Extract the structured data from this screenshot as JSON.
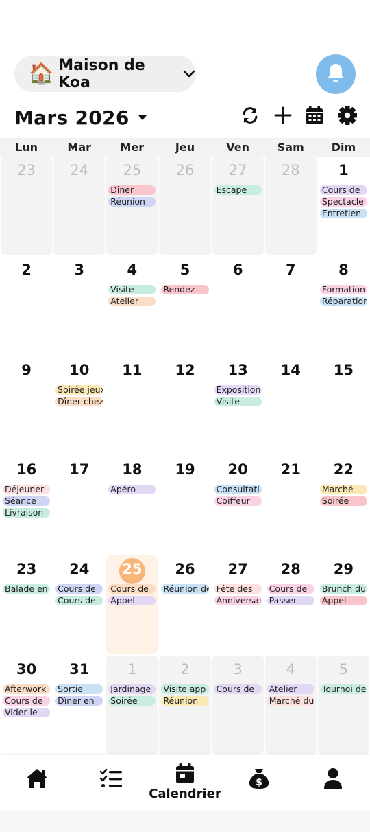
{
  "header": {
    "house_emoji": "🏠",
    "house_name": "Maison de Koa",
    "month_title": "Mars 2026"
  },
  "icons": {
    "chevron": "chevron-down-icon",
    "bell": "bell-icon",
    "refresh": "refresh-icon",
    "add": "plus-icon",
    "calendar": "calendar-icon",
    "settings": "gear-icon"
  },
  "colors": {
    "bell_bg": "#7fbcec",
    "today_circle": "#f9b67a",
    "today_bg": "#fff3e8"
  },
  "weekdays": [
    "Lun",
    "Mar",
    "Mer",
    "Jeu",
    "Ven",
    "Sam",
    "Dim"
  ],
  "weeks": [
    [
      {
        "day": "23",
        "other": true,
        "events": []
      },
      {
        "day": "24",
        "other": true,
        "events": []
      },
      {
        "day": "25",
        "other": true,
        "events": [
          {
            "label": "Dîner",
            "color": "#f9c5cd"
          },
          {
            "label": "Réunion",
            "color": "#cfd6f5"
          }
        ]
      },
      {
        "day": "26",
        "other": true,
        "events": []
      },
      {
        "day": "27",
        "other": true,
        "events": [
          {
            "label": "Escape",
            "color": "#c8ecdf"
          }
        ]
      },
      {
        "day": "28",
        "other": true,
        "events": []
      },
      {
        "day": "1",
        "other": false,
        "events": [
          {
            "label": "Cours de",
            "color": "#e3d7f6"
          },
          {
            "label": "Spectacle",
            "color": "#f9d2e6"
          },
          {
            "label": "Entretien",
            "color": "#c9e1f4"
          }
        ]
      }
    ],
    [
      {
        "day": "2",
        "other": false,
        "events": []
      },
      {
        "day": "3",
        "other": false,
        "events": []
      },
      {
        "day": "4",
        "other": false,
        "events": [
          {
            "label": "Visite",
            "color": "#c8ecdf"
          },
          {
            "label": "Atelier",
            "color": "#fbdcc4"
          }
        ]
      },
      {
        "day": "5",
        "other": false,
        "events": [
          {
            "label": "Rendez-",
            "color": "#f9c5cd"
          }
        ]
      },
      {
        "day": "6",
        "other": false,
        "events": []
      },
      {
        "day": "7",
        "other": false,
        "events": []
      },
      {
        "day": "8",
        "other": false,
        "events": [
          {
            "label": "Formation",
            "color": "#f9d2e6"
          },
          {
            "label": "Réparation",
            "color": "#c9e1f4"
          }
        ]
      }
    ],
    [
      {
        "day": "9",
        "other": false,
        "events": []
      },
      {
        "day": "10",
        "other": false,
        "events": [
          {
            "label": "Soirée jeux",
            "color": "#fbe9b5"
          },
          {
            "label": "Dîner chez",
            "color": "#fbdcc4"
          }
        ]
      },
      {
        "day": "11",
        "other": false,
        "events": []
      },
      {
        "day": "12",
        "other": false,
        "events": []
      },
      {
        "day": "13",
        "other": false,
        "events": [
          {
            "label": "Exposition",
            "color": "#e3d7f6"
          },
          {
            "label": "Visite",
            "color": "#c8ecdf"
          }
        ]
      },
      {
        "day": "14",
        "other": false,
        "events": []
      },
      {
        "day": "15",
        "other": false,
        "events": []
      }
    ],
    [
      {
        "day": "16",
        "other": false,
        "events": [
          {
            "label": "Déjeuner",
            "color": "#fde0e0"
          },
          {
            "label": "Séance",
            "color": "#cfd6f5"
          },
          {
            "label": "Livraison",
            "color": "#c8ecdf"
          }
        ]
      },
      {
        "day": "17",
        "other": false,
        "events": []
      },
      {
        "day": "18",
        "other": false,
        "events": [
          {
            "label": "Apéro",
            "color": "#e3d7f6"
          }
        ]
      },
      {
        "day": "19",
        "other": false,
        "events": []
      },
      {
        "day": "20",
        "other": false,
        "events": [
          {
            "label": "Consultati",
            "color": "#c9e1f4"
          },
          {
            "label": "Coiffeur",
            "color": "#f9d2e6"
          }
        ]
      },
      {
        "day": "21",
        "other": false,
        "events": []
      },
      {
        "day": "22",
        "other": false,
        "events": [
          {
            "label": "Marché",
            "color": "#fbe9b5"
          },
          {
            "label": "Soirée",
            "color": "#f9c5cd"
          }
        ]
      }
    ],
    [
      {
        "day": "23",
        "other": false,
        "events": [
          {
            "label": "Balade en",
            "color": "#c8ecdf"
          }
        ]
      },
      {
        "day": "24",
        "other": false,
        "events": [
          {
            "label": "Cours de",
            "color": "#cfd6f5"
          },
          {
            "label": "Cours de",
            "color": "#c8ecdf"
          }
        ]
      },
      {
        "day": "25",
        "other": false,
        "today": true,
        "events": [
          {
            "label": "Cours de",
            "color": "#fbdcc4"
          },
          {
            "label": "Appel",
            "color": "#e3d7f6"
          }
        ]
      },
      {
        "day": "26",
        "other": false,
        "events": [
          {
            "label": "Réunion de",
            "color": "#c9e1f4"
          }
        ]
      },
      {
        "day": "27",
        "other": false,
        "events": [
          {
            "label": "Fête des",
            "color": "#fde0e0"
          },
          {
            "label": "Anniversai",
            "color": "#f9d2e6"
          }
        ]
      },
      {
        "day": "28",
        "other": false,
        "events": [
          {
            "label": "Cours de",
            "color": "#f9d2e6"
          },
          {
            "label": "Passer",
            "color": "#e3d7f6"
          }
        ]
      },
      {
        "day": "29",
        "other": false,
        "events": [
          {
            "label": "Brunch du",
            "color": "#c8ecdf"
          },
          {
            "label": "Appel",
            "color": "#f9c5cd"
          }
        ]
      }
    ],
    [
      {
        "day": "30",
        "other": false,
        "events": [
          {
            "label": "Afterwork",
            "color": "#fbdcc4"
          },
          {
            "label": "Cours de",
            "color": "#f9d2e6"
          },
          {
            "label": "Vider le",
            "color": "#e3d7f6"
          }
        ]
      },
      {
        "day": "31",
        "other": false,
        "events": [
          {
            "label": "Sortie",
            "color": "#c9e1f4"
          },
          {
            "label": "Dîner en",
            "color": "#cfd6f5"
          }
        ]
      },
      {
        "day": "1",
        "other": true,
        "events": [
          {
            "label": "Jardinage",
            "color": "#e3d7f6"
          },
          {
            "label": "Soirée",
            "color": "#c8ecdf"
          }
        ]
      },
      {
        "day": "2",
        "other": true,
        "events": [
          {
            "label": "Visite app",
            "color": "#c8ecdf"
          },
          {
            "label": "Réunion",
            "color": "#fbe9b5"
          }
        ]
      },
      {
        "day": "3",
        "other": true,
        "events": [
          {
            "label": "Cours de",
            "color": "#e3d7f6"
          }
        ]
      },
      {
        "day": "4",
        "other": true,
        "events": [
          {
            "label": "Atelier",
            "color": "#e3d7f6"
          },
          {
            "label": "Marché du",
            "color": "#fde0e0"
          }
        ]
      },
      {
        "day": "5",
        "other": true,
        "events": [
          {
            "label": "Tournoi de",
            "color": "#c8ecdf"
          }
        ]
      }
    ]
  ],
  "tabbar": {
    "items": [
      {
        "name": "home",
        "icon": "home-icon",
        "label": ""
      },
      {
        "name": "tasks",
        "icon": "checklist-icon",
        "label": ""
      },
      {
        "name": "calendar",
        "icon": "calendar-icon",
        "label": "Calendrier"
      },
      {
        "name": "budget",
        "icon": "money-bag-icon",
        "label": ""
      },
      {
        "name": "profile",
        "icon": "user-icon",
        "label": ""
      }
    ]
  }
}
